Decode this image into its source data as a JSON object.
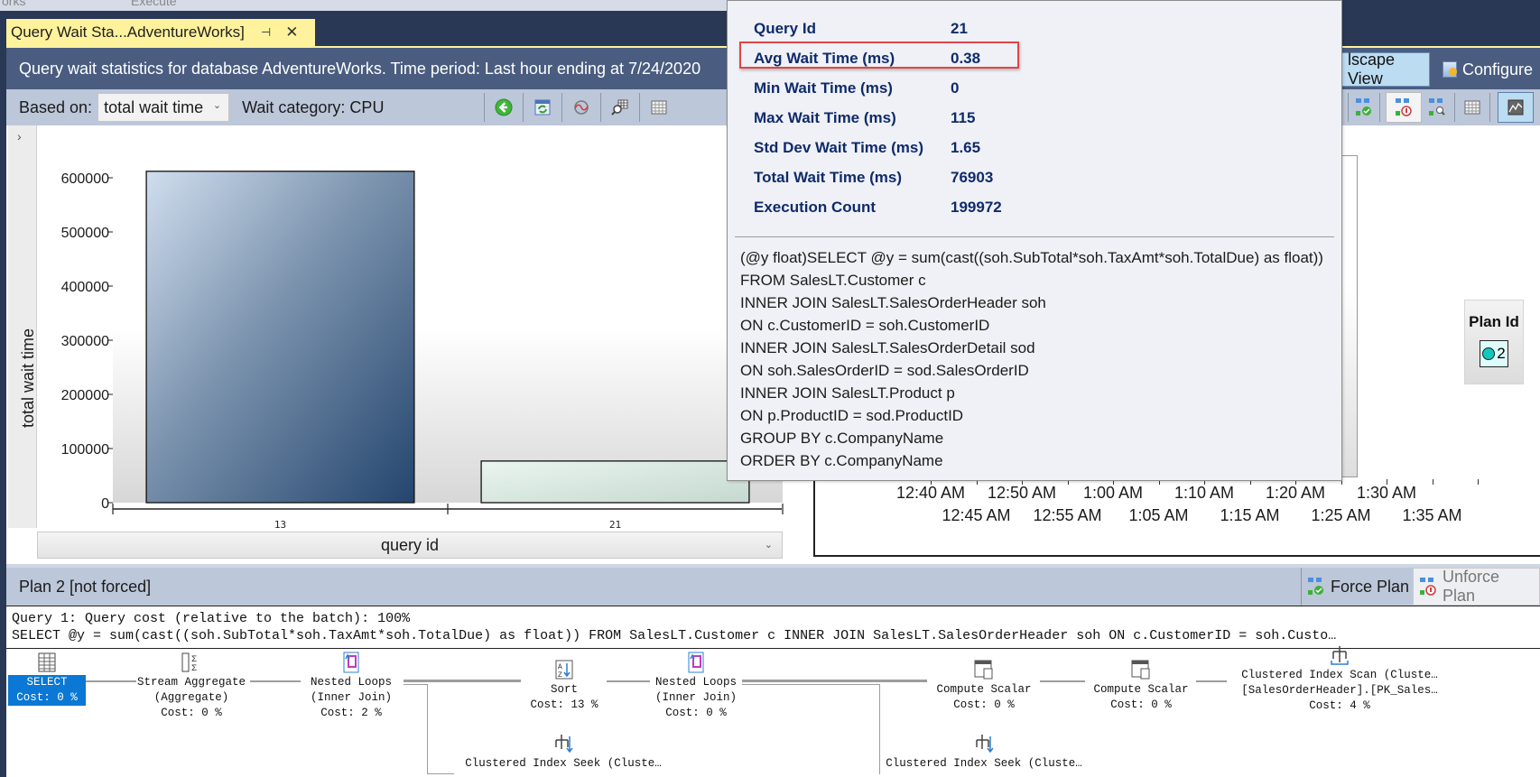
{
  "top_strip": {
    "db_fragment": "orks",
    "execute_label": "Execute"
  },
  "document_tab": {
    "title": "Query Wait Sta...AdventureWorks]",
    "pin_icon": "pin-icon",
    "close_icon": "close-icon"
  },
  "report_header": {
    "title": "Query wait statistics for database AdventureWorks. Time period: Last hour ending at 7/24/2020",
    "landscape_view_label": "lscape View",
    "configure_label": "Configure"
  },
  "left_toolbar": {
    "based_on_label": "Based on:",
    "based_on_value": "total wait time",
    "wait_category_label": "Wait category: CPU",
    "icons": [
      "back-icon",
      "refresh-icon",
      "chart-icon",
      "grid-search-icon",
      "grid-icon"
    ]
  },
  "right_toolbar": {
    "icons": [
      "force-plan-icon",
      "unforce-plan-icon",
      "compare-plans-icon",
      "grid-icon",
      "chart-icon"
    ]
  },
  "chart_data": [
    {
      "type": "bar",
      "title": "",
      "xlabel": "query id",
      "ylabel": "total wait time",
      "categories": [
        "13",
        "21"
      ],
      "values": [
        612000,
        76903
      ],
      "ylim": [
        0,
        630000
      ],
      "yticks": [
        0,
        100000,
        200000,
        300000,
        400000,
        500000,
        600000
      ],
      "colors": [
        "#2d4d74",
        "#cfe2d8"
      ],
      "grid": false
    },
    {
      "type": "scatter",
      "title": "",
      "xlabel": "",
      "ylabel": "",
      "x_ticks_row1": [
        "12:40 AM",
        "12:50 AM",
        "1:00 AM",
        "1:10 AM",
        "1:20 AM",
        "1:30 AM"
      ],
      "x_ticks_row2": [
        "12:45 AM",
        "12:55 AM",
        "1:05 AM",
        "1:15 AM",
        "1:25 AM",
        "1:35 AM"
      ],
      "legend": {
        "title": "Plan Id",
        "items": [
          {
            "label": "2",
            "color": "#12c8c0"
          }
        ],
        "placement": "right"
      },
      "series": []
    }
  ],
  "tooltip": {
    "rows": [
      {
        "key": "Query Id",
        "value": "21"
      },
      {
        "key": "Avg Wait Time (ms)",
        "value": "0.38"
      },
      {
        "key": "Min Wait Time (ms)",
        "value": "0"
      },
      {
        "key": "Max Wait Time (ms)",
        "value": "115"
      },
      {
        "key": "Std Dev Wait Time (ms)",
        "value": "1.65"
      },
      {
        "key": "Total Wait Time (ms)",
        "value": "76903"
      },
      {
        "key": "Execution Count",
        "value": "199972"
      }
    ],
    "highlighted_row": "Avg Wait Time (ms)",
    "sql_lines": [
      "(@y float)SELECT @y = sum(cast((soh.SubTotal*soh.TaxAmt*soh.TotalDue) as float))",
      "FROM SalesLT.Customer c",
      "INNER JOIN SalesLT.SalesOrderHeader soh",
      "ON c.CustomerID = soh.CustomerID",
      "INNER JOIN SalesLT.SalesOrderDetail sod",
      "ON soh.SalesOrderID = sod.SalesOrderID",
      "INNER JOIN SalesLT.Product p",
      "ON p.ProductID = sod.ProductID",
      "GROUP BY c.CompanyName",
      "ORDER BY c.CompanyName"
    ]
  },
  "plan": {
    "title": "Plan 2 [not forced]",
    "force_plan_label": "Force Plan",
    "unforce_plan_label": "Unforce Plan",
    "query_cost_line": "Query 1: Query cost (relative to the batch): 100%",
    "query_text_line": "SELECT @y = sum(cast((soh.SubTotal*soh.TaxAmt*soh.TotalDue) as float)) FROM SalesLT.Customer c INNER JOIN SalesLT.SalesOrderHeader soh ON c.CustomerID = soh.Custo…",
    "nodes": [
      {
        "name": "SELECT",
        "sub": "",
        "cost": "Cost: 0 %",
        "icon": "select-icon"
      },
      {
        "name": "Stream Aggregate",
        "sub": "(Aggregate)",
        "cost": "Cost: 0 %",
        "icon": "stream-aggregate-icon"
      },
      {
        "name": "Nested Loops",
        "sub": "(Inner Join)",
        "cost": "Cost: 2 %",
        "icon": "nested-loops-icon"
      },
      {
        "name": "Sort",
        "sub": "",
        "cost": "Cost: 13 %",
        "icon": "sort-icon"
      },
      {
        "name": "Nested Loops",
        "sub": "(Inner Join)",
        "cost": "Cost: 0 %",
        "icon": "nested-loops-icon"
      },
      {
        "name": "Compute Scalar",
        "sub": "",
        "cost": "Cost: 0 %",
        "icon": "compute-scalar-icon"
      },
      {
        "name": "Compute Scalar",
        "sub": "",
        "cost": "Cost: 0 %",
        "icon": "compute-scalar-icon"
      },
      {
        "name": "Clustered Index Scan (Cluste…",
        "sub": "[SalesOrderHeader].[PK_Sales…",
        "cost": "Cost: 4 %",
        "icon": "clustered-index-scan-icon"
      },
      {
        "name": "Clustered Index Seek (Cluste…",
        "sub": "",
        "cost": "",
        "icon": "clustered-index-seek-icon"
      },
      {
        "name": "Clustered Index Seek (Cluste…",
        "sub": "",
        "cost": "",
        "icon": "clustered-index-seek-icon"
      }
    ]
  }
}
